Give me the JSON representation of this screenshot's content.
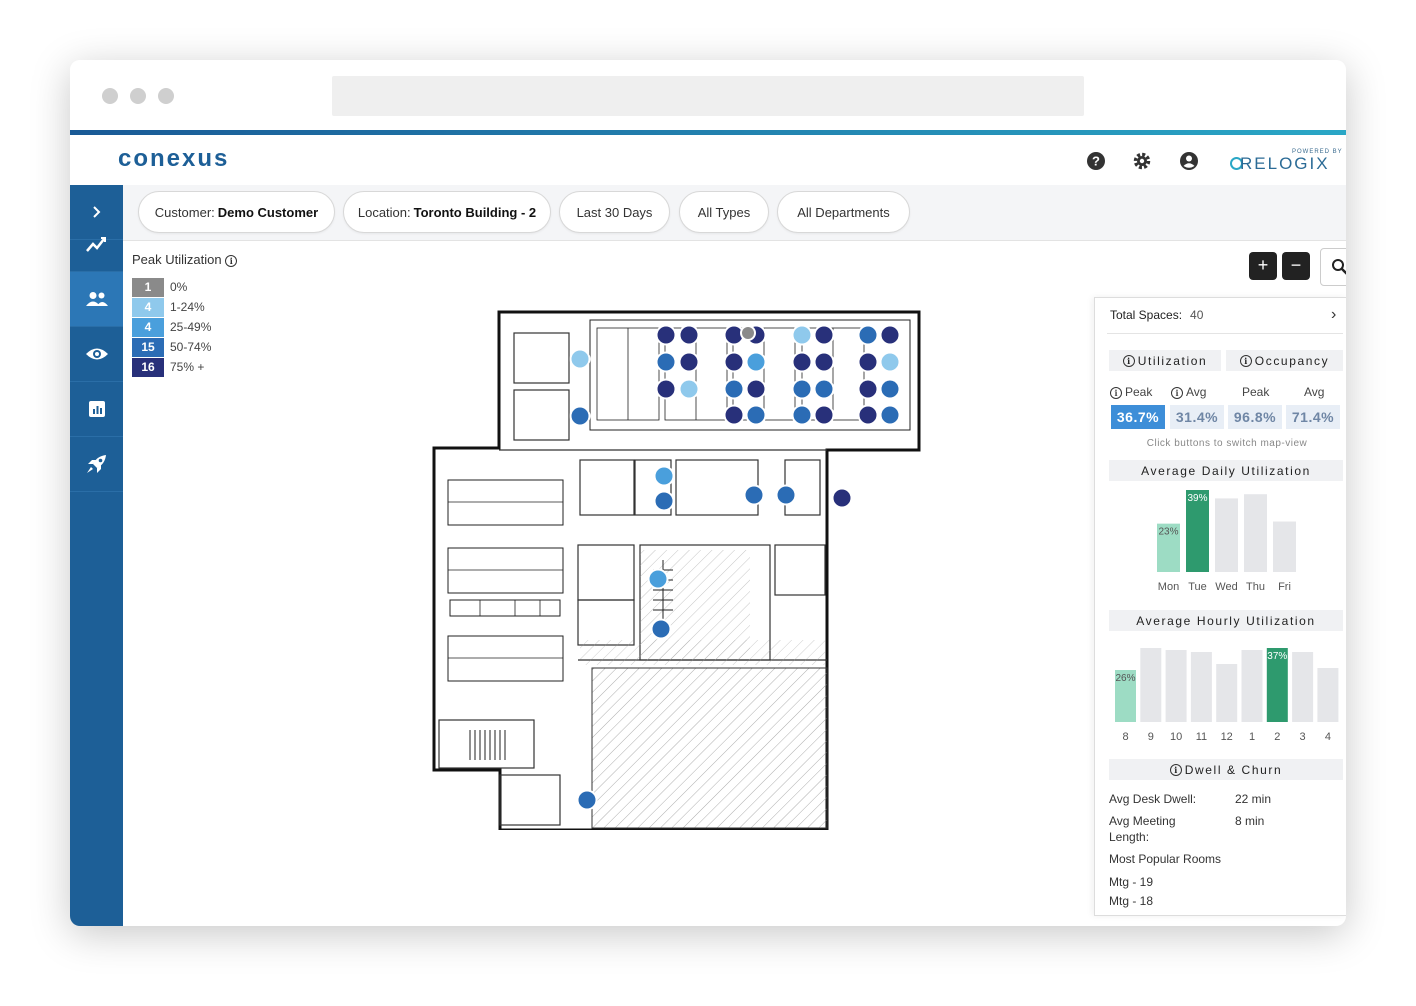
{
  "header": {
    "logo": "conexus",
    "brand_powered": "POWERED BY",
    "brand_name": "RELOGIX"
  },
  "filters": [
    {
      "label": "Customer:",
      "value": "Demo Customer"
    },
    {
      "label": "Location:",
      "value": "Toronto Building - 2"
    },
    {
      "label": "Last 30 Days",
      "value": ""
    },
    {
      "label": "All Types",
      "value": ""
    },
    {
      "label": "All Departments",
      "value": ""
    }
  ],
  "legend": {
    "title": "Peak Utilization",
    "items": [
      {
        "count": "1",
        "range": "0%",
        "color": "#8a8a8a"
      },
      {
        "count": "4",
        "range": "1-24%",
        "color": "#8fc9ec"
      },
      {
        "count": "4",
        "range": "25-49%",
        "color": "#4a9fdc"
      },
      {
        "count": "15",
        "range": "50-74%",
        "color": "#2b6cb5"
      },
      {
        "count": "16",
        "range": "75% +",
        "color": "#28307a"
      }
    ]
  },
  "zoom": {
    "in": "+",
    "out": "−"
  },
  "panel": {
    "total_label": "Total Spaces:",
    "total_value": "40",
    "tab_utilization": "Utilization",
    "tab_occupancy": "Occupancy",
    "sub_peak": "Peak",
    "sub_avg": "Avg",
    "sub_peak2": "Peak",
    "sub_avg2": "Avg",
    "metrics": [
      "36.7%",
      "31.4%",
      "96.8%",
      "71.4%"
    ],
    "hint": "Click buttons to switch map-view",
    "daily_title": "Average Daily Utilization",
    "hourly_title": "Average Hourly Utilization",
    "dwell_title": "Dwell & Churn",
    "dwell": {
      "desk_label": "Avg Desk Dwell:",
      "desk_value": "22 min",
      "meeting_label_1": "Avg Meeting",
      "meeting_label_2": "Length:",
      "meeting_value": "8 min",
      "popular_label": "Most Popular Rooms",
      "rooms": [
        "Mtg - 19",
        "Mtg - 18"
      ]
    }
  },
  "chart_data": [
    {
      "type": "bar",
      "title": "Average Daily Utilization",
      "categories": [
        "Mon",
        "Tue",
        "Wed",
        "Thu",
        "Fri"
      ],
      "values": [
        23,
        39,
        35,
        37,
        24
      ],
      "labels": [
        "23%",
        "39%",
        "",
        "",
        ""
      ],
      "colors": [
        "#9ddcc4",
        "#2e9a6e",
        "#e5e6e9",
        "#e5e6e9",
        "#e5e6e9"
      ]
    },
    {
      "type": "bar",
      "title": "Average Hourly Utilization",
      "categories": [
        "8",
        "9",
        "10",
        "11",
        "12",
        "1",
        "2",
        "3",
        "4"
      ],
      "values": [
        26,
        37,
        36,
        35,
        29,
        36,
        37,
        35,
        27
      ],
      "labels": [
        "26%",
        "",
        "",
        "",
        "",
        "",
        "37%",
        "",
        ""
      ],
      "colors": [
        "#9ddcc4",
        "#e5e6e9",
        "#e5e6e9",
        "#e5e6e9",
        "#e5e6e9",
        "#e5e6e9",
        "#2e9a6e",
        "#e5e6e9",
        "#e5e6e9"
      ]
    }
  ]
}
